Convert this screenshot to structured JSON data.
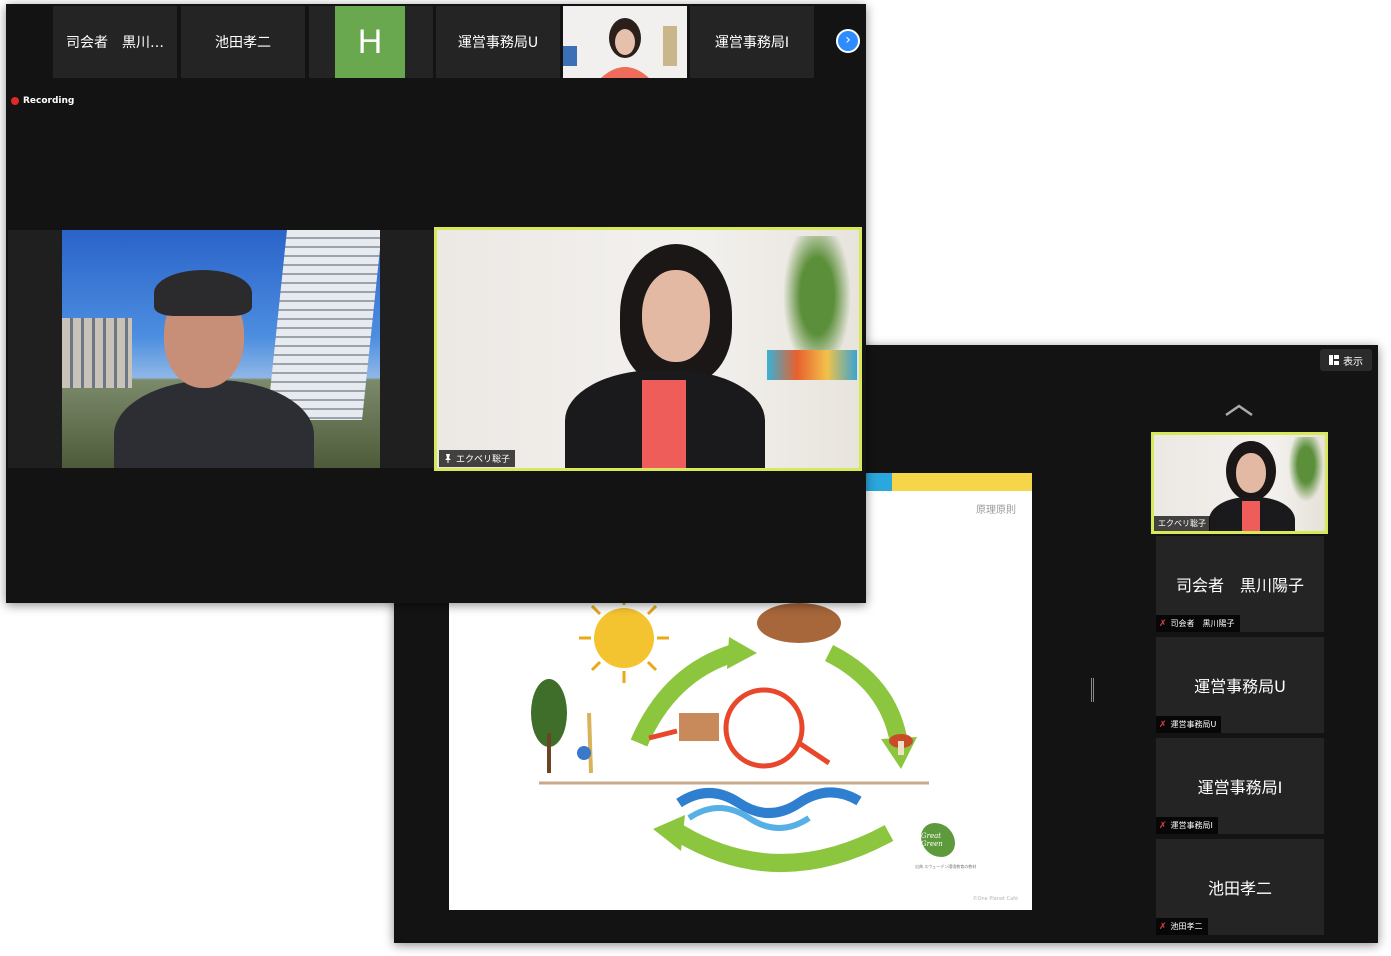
{
  "front": {
    "participants": [
      {
        "label": "司会者　黒川…"
      },
      {
        "label": "池田孝二"
      },
      {
        "label": "H",
        "color": "#6aa84f"
      },
      {
        "label": "運営事務局U"
      },
      {
        "label": ""
      },
      {
        "label": "運営事務局I"
      }
    ],
    "recording_label": "Recording",
    "next_icon": "chevron-right-icon",
    "speaker_tag": "エクベリ聡子",
    "active_border": "#d7e85a"
  },
  "back": {
    "view_button": "表示",
    "slide": {
      "title": "原理原則",
      "caption": "出典 スウェーデン環境教育の教材",
      "copyright": "©One Planet Café",
      "logo": "Great Green"
    },
    "gallery": {
      "active_tag": "エクベリ聡子",
      "items": [
        {
          "name": "司会者　黒川陽子",
          "tag": "司会者　黒川陽子"
        },
        {
          "name": "運営事務局U",
          "tag": "運営事務局U"
        },
        {
          "name": "運営事務局I",
          "tag": "運営事務局I"
        },
        {
          "name": "池田孝二",
          "tag": "池田孝二"
        }
      ]
    }
  }
}
